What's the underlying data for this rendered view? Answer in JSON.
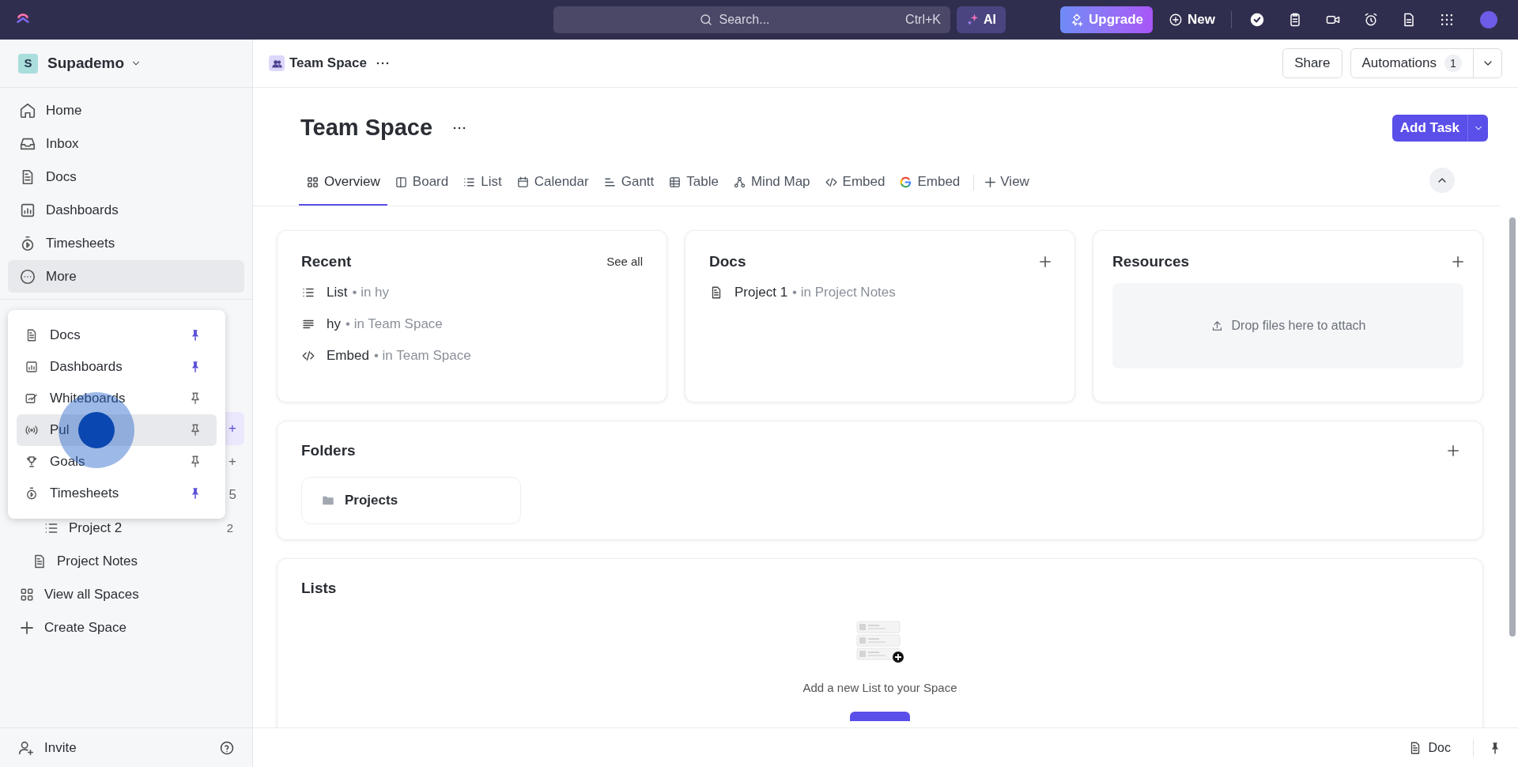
{
  "topbar": {
    "search_placeholder": "Search...",
    "shortcut": "Ctrl+K",
    "ai": "AI",
    "upgrade": "Upgrade",
    "new": "New"
  },
  "workspace": {
    "initial": "S",
    "name": "Supademo"
  },
  "nav": [
    {
      "label": "Home",
      "kind": "home",
      "selected": false
    },
    {
      "label": "Inbox",
      "kind": "inbox",
      "selected": false
    },
    {
      "label": "Docs",
      "kind": "doc",
      "selected": false
    },
    {
      "label": "Dashboards",
      "kind": "dashboard",
      "selected": false
    },
    {
      "label": "Timesheets",
      "kind": "timer",
      "selected": false
    },
    {
      "label": "More",
      "kind": "more",
      "selected": true
    }
  ],
  "space_rows": [
    {
      "trailing": "+",
      "selected": true
    },
    {
      "trailing": "+",
      "selected": false
    },
    {
      "trailing": "5",
      "selected": false
    }
  ],
  "tree": [
    {
      "label": "Project 2",
      "kind": "list",
      "count": "2"
    },
    {
      "label": "Project Notes",
      "kind": "doc"
    }
  ],
  "sidebar_actions": [
    {
      "label": "View all Spaces",
      "kind": "grid"
    },
    {
      "label": "Create Space",
      "kind": "plus"
    }
  ],
  "footer": {
    "invite": "Invite"
  },
  "more_menu": [
    {
      "label": "Docs",
      "kind": "doc",
      "pinned": true,
      "selected": false
    },
    {
      "label": "Dashboards",
      "kind": "dashboard",
      "pinned": true,
      "selected": false
    },
    {
      "label": "Whiteboards",
      "kind": "whiteboard",
      "pinned": false,
      "selected": false
    },
    {
      "label": "Pul",
      "kind": "pulse",
      "pinned": false,
      "selected": true
    },
    {
      "label": "Goals",
      "kind": "trophy",
      "pinned": false,
      "selected": false
    },
    {
      "label": "Timesheets",
      "kind": "timer",
      "pinned": true,
      "selected": false
    }
  ],
  "header": {
    "breadcrumb": "Team Space",
    "share": "Share",
    "automations": "Automations",
    "automations_count": "1"
  },
  "title": "Team Space",
  "add_task": "Add Task",
  "views": [
    {
      "label": "Overview",
      "kind": "overview",
      "selected": true
    },
    {
      "label": "Board",
      "kind": "board",
      "selected": false
    },
    {
      "label": "List",
      "kind": "list",
      "selected": false
    },
    {
      "label": "Calendar",
      "kind": "calendar",
      "selected": false
    },
    {
      "label": "Gantt",
      "kind": "gantt",
      "selected": false
    },
    {
      "label": "Table",
      "kind": "table",
      "selected": false
    },
    {
      "label": "Mind Map",
      "kind": "mindmap",
      "selected": false
    },
    {
      "label": "Embed",
      "kind": "code",
      "selected": false
    },
    {
      "label": "Embed",
      "kind": "google",
      "selected": false
    }
  ],
  "add_view": "View",
  "recent": {
    "title": "Recent",
    "see_all": "See all",
    "items": [
      {
        "name": "List",
        "location": "• in hy",
        "kind": "list"
      },
      {
        "name": "hy",
        "location": "• in Team Space",
        "kind": "lines"
      },
      {
        "name": "Embed",
        "location": "• in Team Space",
        "kind": "code"
      }
    ]
  },
  "docs": {
    "title": "Docs",
    "items": [
      {
        "name": "Project 1",
        "location": "• in Project Notes",
        "kind": "doc"
      }
    ]
  },
  "resources": {
    "title": "Resources",
    "dropzone": "Drop files here to attach"
  },
  "folders": {
    "title": "Folders",
    "items": [
      "Projects"
    ]
  },
  "lists": {
    "title": "Lists",
    "empty": "Add a new List to your Space"
  },
  "bottom": {
    "doc": "Doc"
  }
}
